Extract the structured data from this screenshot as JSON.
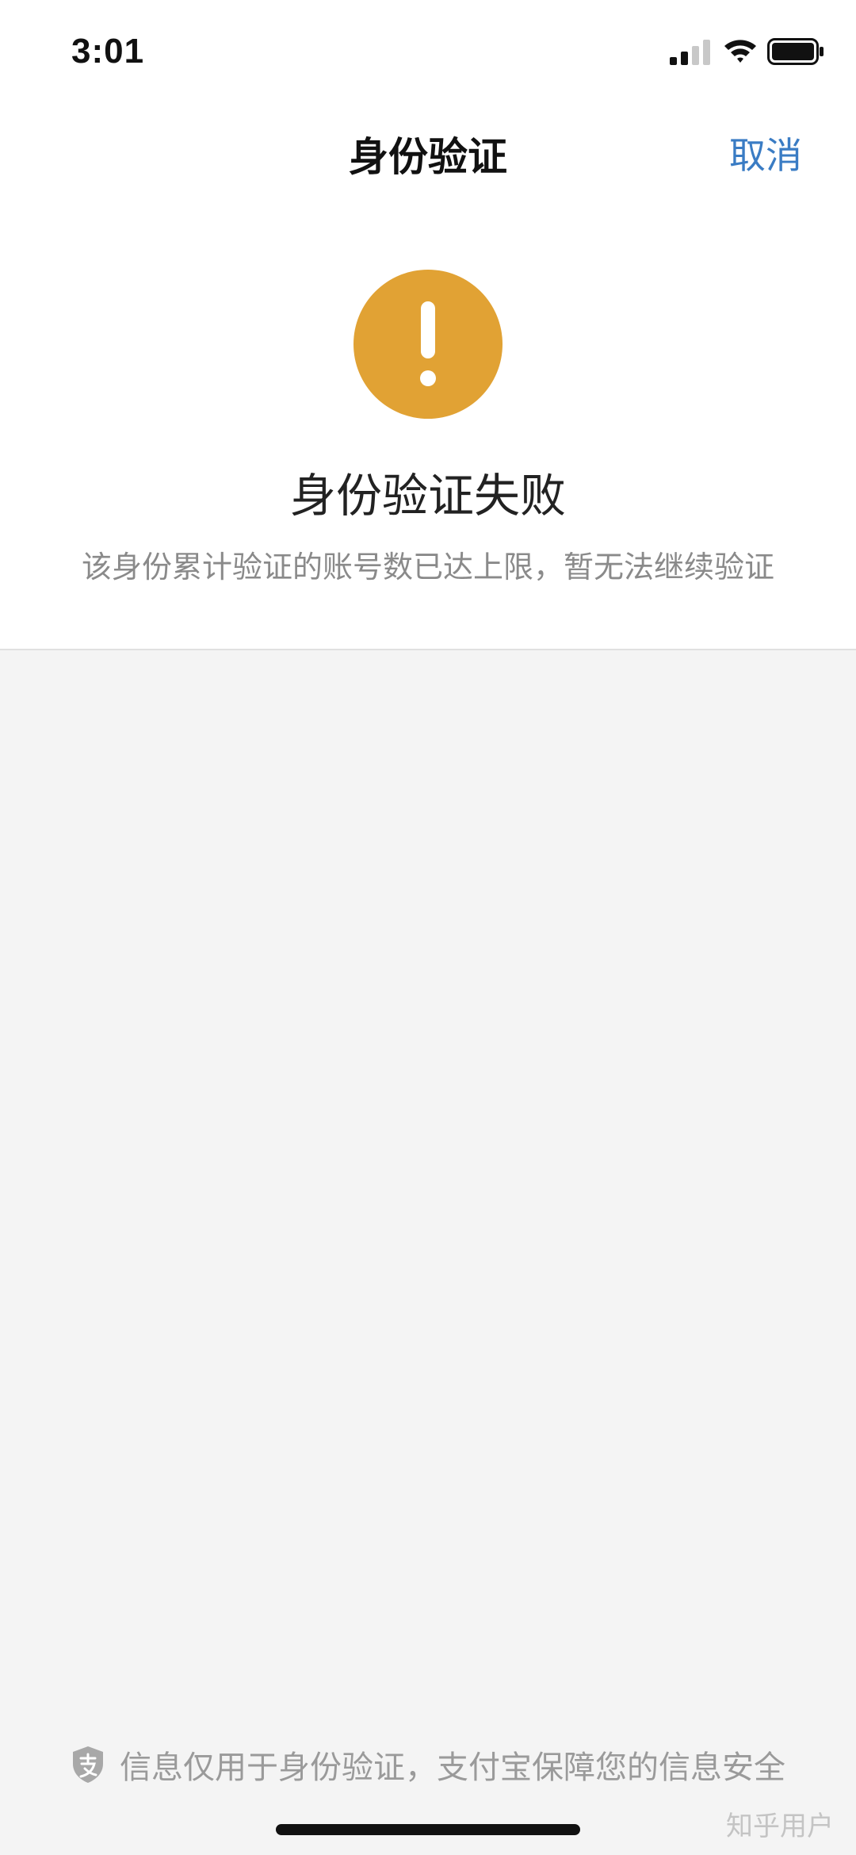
{
  "status_bar": {
    "time": "3:01",
    "signal_icon": "cellular-signal-icon",
    "wifi_icon": "wifi-icon",
    "battery_icon": "battery-icon"
  },
  "nav": {
    "title": "身份验证",
    "cancel_label": "取消"
  },
  "result": {
    "icon": "warning-exclamation-icon",
    "icon_color": "#e1a234",
    "title": "身份验证失败",
    "description": "该身份累计验证的账号数已达上限，暂无法继续验证"
  },
  "footer": {
    "icon": "alipay-shield-icon",
    "text": "信息仅用于身份验证，支付宝保障您的信息安全"
  },
  "watermark": "知乎用户",
  "colors": {
    "accent": "#3a7cc4",
    "warning": "#e1a234",
    "background": "#f4f4f4"
  }
}
